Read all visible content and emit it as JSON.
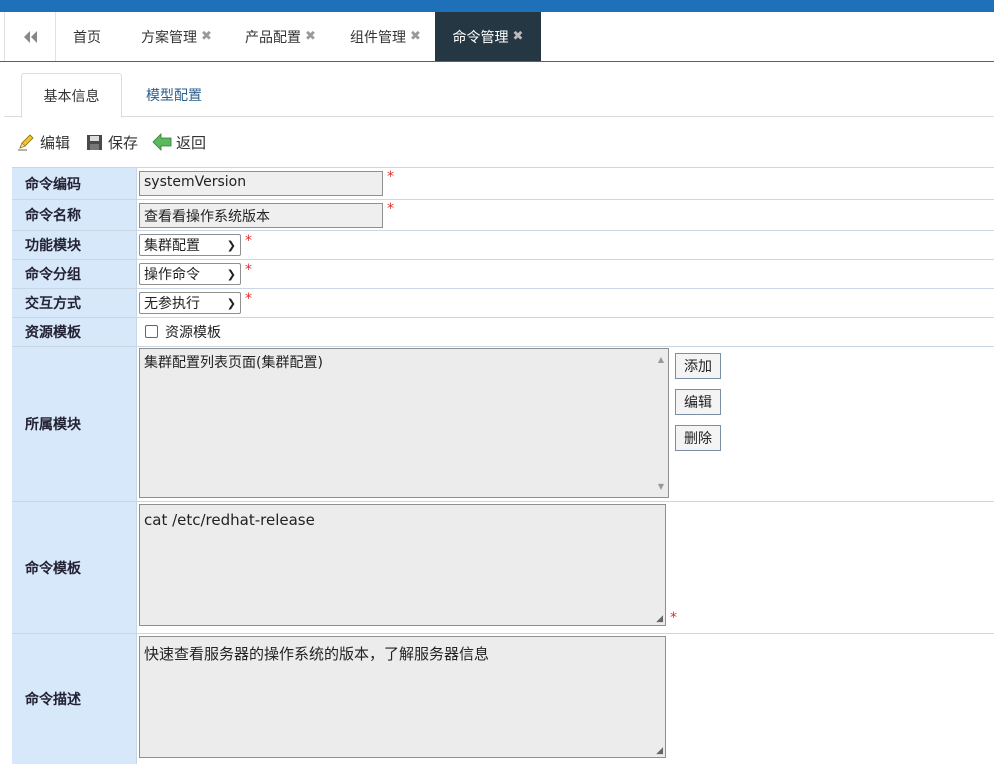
{
  "tabs": {
    "items": [
      {
        "label": "首页",
        "closable": false
      },
      {
        "label": "方案管理",
        "closable": true
      },
      {
        "label": "产品配置",
        "closable": true
      },
      {
        "label": "组件管理",
        "closable": true
      },
      {
        "label": "命令管理",
        "closable": true,
        "active": true
      }
    ],
    "close_glyph": "✖"
  },
  "subtabs": [
    "基本信息",
    "模型配置"
  ],
  "toolbar": {
    "edit": "编辑",
    "save": "保存",
    "back": "返回"
  },
  "form": {
    "code": {
      "label": "命令编码",
      "value": "systemVersion"
    },
    "name": {
      "label": "命令名称",
      "value": "查看看操作系统版本"
    },
    "module": {
      "label": "功能模块",
      "value": "集群配置"
    },
    "group": {
      "label": "命令分组",
      "value": "操作命令"
    },
    "interaction": {
      "label": "交互方式",
      "value": "无参执行"
    },
    "resource": {
      "label": "资源模板",
      "checkbox_label": "资源模板",
      "checked": false
    },
    "owner_module": {
      "label": "所属模块",
      "items": [
        "集群配置列表页面(集群配置)"
      ],
      "add": "添加",
      "edit": "编辑",
      "delete": "删除"
    },
    "template": {
      "label": "命令模板",
      "value": "cat /etc/redhat-release"
    },
    "description": {
      "label": "命令描述",
      "value": "快速查看服务器的操作系统的版本，了解服务器信息"
    }
  },
  "required_mark": "*",
  "colors": {
    "topbar": "#1e71b8",
    "active_tab": "#253743",
    "label_bg": "#d8e8fb",
    "required": "#d9302c"
  }
}
